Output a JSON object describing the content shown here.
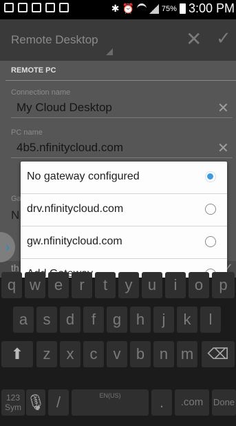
{
  "status_bar": {
    "battery": "75%",
    "time": "3:00 PM",
    "icons": [
      "notification-icon",
      "tools-icon",
      "image-icon",
      "settings-icon",
      "voicemail-icon",
      "bluetooth-icon",
      "alarm-icon",
      "wifi-icon",
      "signal-icon",
      "battery-icon"
    ]
  },
  "action_bar": {
    "title": "Remote Desktop",
    "close_icon": "close-icon",
    "confirm_icon": "check-icon"
  },
  "form": {
    "section_header": "REMOTE PC",
    "connection_name": {
      "label": "Connection name",
      "value": "My Cloud Desktop"
    },
    "pc_name": {
      "label": "PC name",
      "value": "4b5.nfinitycloud.com"
    },
    "gateway_partial": {
      "label": "Ga",
      "value": "N"
    },
    "below_partial": "th"
  },
  "gateway_dialog": {
    "options": [
      {
        "label": "No gateway configured",
        "selected": true
      },
      {
        "label": "drv.nfinitycloud.com",
        "selected": false
      },
      {
        "label": "gw.nfinitycloud.com",
        "selected": false
      },
      {
        "label": "Add Gateway",
        "selected": false
      }
    ],
    "accent_color": "#3f9be0"
  },
  "keyboard": {
    "row1": [
      "q",
      "w",
      "e",
      "r",
      "t",
      "y",
      "u",
      "i",
      "o",
      "p"
    ],
    "row2": [
      "a",
      "s",
      "d",
      "f",
      "g",
      "h",
      "j",
      "k",
      "l"
    ],
    "row3": [
      "z",
      "x",
      "c",
      "v",
      "b",
      "n",
      "m"
    ],
    "mode_key": "123 Sym",
    "slash_key": "/",
    "space_label": "EN(US)",
    "period_key": ".",
    "com_key": ".com",
    "done_key": "Done"
  }
}
